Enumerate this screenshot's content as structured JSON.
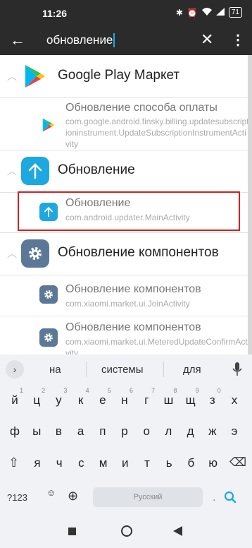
{
  "status_bar": {
    "time": "11:26",
    "battery": "71"
  },
  "search": {
    "query": "обновление"
  },
  "groups": [
    {
      "title": "Google Play Маркет",
      "activities": [
        {
          "name": "Обновление способа оплаты",
          "package": "com.google.android.finsky.billing.updatesubscriptioninstrument.UpdateSubscriptionInstrumentActivity"
        }
      ]
    },
    {
      "title": "Обновление",
      "activities": [
        {
          "name": "Обновление",
          "package": "com.android.updater.MainActivity"
        }
      ]
    },
    {
      "title": "Обновление компонентов",
      "activities": [
        {
          "name": "Обновление компонентов",
          "package": "com.xiaomi.market.ui.JoinActivity"
        },
        {
          "name": "Обновление компонентов",
          "package": "com.xiaomi.market.ui.MeteredUpdateConfirmActivity"
        }
      ]
    }
  ],
  "keyboard": {
    "suggestions": [
      "на",
      "системы",
      "для"
    ],
    "row1": [
      "й",
      "ц",
      "у",
      "к",
      "е",
      "н",
      "г",
      "ш",
      "щ",
      "з",
      "х"
    ],
    "row1_hints": [
      "1",
      "2",
      "3",
      "4",
      "5",
      "6",
      "7",
      "8",
      "9",
      "0",
      ""
    ],
    "row2": [
      "ф",
      "ы",
      "в",
      "а",
      "п",
      "р",
      "о",
      "л",
      "д",
      "ж",
      "э"
    ],
    "row3": [
      "я",
      "ч",
      "с",
      "м",
      "и",
      "т",
      "ь",
      "б",
      "ю"
    ],
    "symbols_key": "?123",
    "space_label": "Русский"
  },
  "colors": {
    "accent": "#1ea8e0",
    "highlight": "#d32020",
    "settings_icon": "#5b7896"
  }
}
